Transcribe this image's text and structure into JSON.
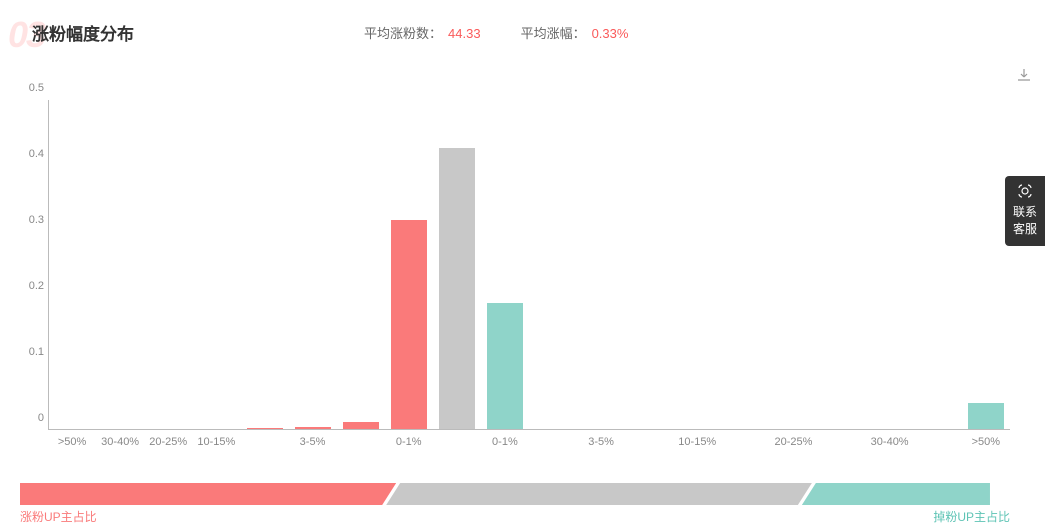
{
  "header": {
    "bg_number": "03",
    "title": "涨粉幅度分布",
    "stat1_label": "平均涨粉数：",
    "stat1_value": "44.33",
    "stat2_label": "平均涨幅：",
    "stat2_value": "0.33%"
  },
  "contact": "联系客服",
  "legend": {
    "left": "涨粉UP主占比",
    "right": "掉粉UP主占比"
  },
  "legend_proportions": {
    "pink": 0.38,
    "gray": 0.43,
    "teal": 0.19
  },
  "chart_data": {
    "type": "bar",
    "title": "涨粉幅度分布",
    "ylabel": "",
    "ylim": [
      0,
      0.5
    ],
    "y_ticks": [
      0,
      0.1,
      0.2,
      0.3,
      0.4,
      0.5
    ],
    "categories": [
      ">50%",
      "30-40%",
      "20-25%",
      "10-15%",
      "",
      "3-5%",
      "",
      "0-1%",
      "",
      "0-1%",
      "",
      "3-5%",
      "",
      "10-15%",
      "",
      "20-25%",
      "",
      "30-40%",
      "",
      ">50%"
    ],
    "bars": [
      {
        "color": "pink",
        "value": 0
      },
      {
        "color": "pink",
        "value": 0
      },
      {
        "color": "pink",
        "value": 0
      },
      {
        "color": "pink",
        "value": 0
      },
      {
        "color": "pink",
        "value": 0.002
      },
      {
        "color": "pink",
        "value": 0.003
      },
      {
        "color": "pink",
        "value": 0.011
      },
      {
        "color": "pink",
        "value": 0.316
      },
      {
        "color": "gray",
        "value": 0.426
      },
      {
        "color": "teal",
        "value": 0.191
      },
      {
        "color": "teal",
        "value": 0
      },
      {
        "color": "teal",
        "value": 0
      },
      {
        "color": "teal",
        "value": 0
      },
      {
        "color": "teal",
        "value": 0
      },
      {
        "color": "teal",
        "value": 0
      },
      {
        "color": "teal",
        "value": 0
      },
      {
        "color": "teal",
        "value": 0
      },
      {
        "color": "teal",
        "value": 0
      },
      {
        "color": "teal",
        "value": 0
      },
      {
        "color": "teal",
        "value": 0.039
      }
    ]
  }
}
